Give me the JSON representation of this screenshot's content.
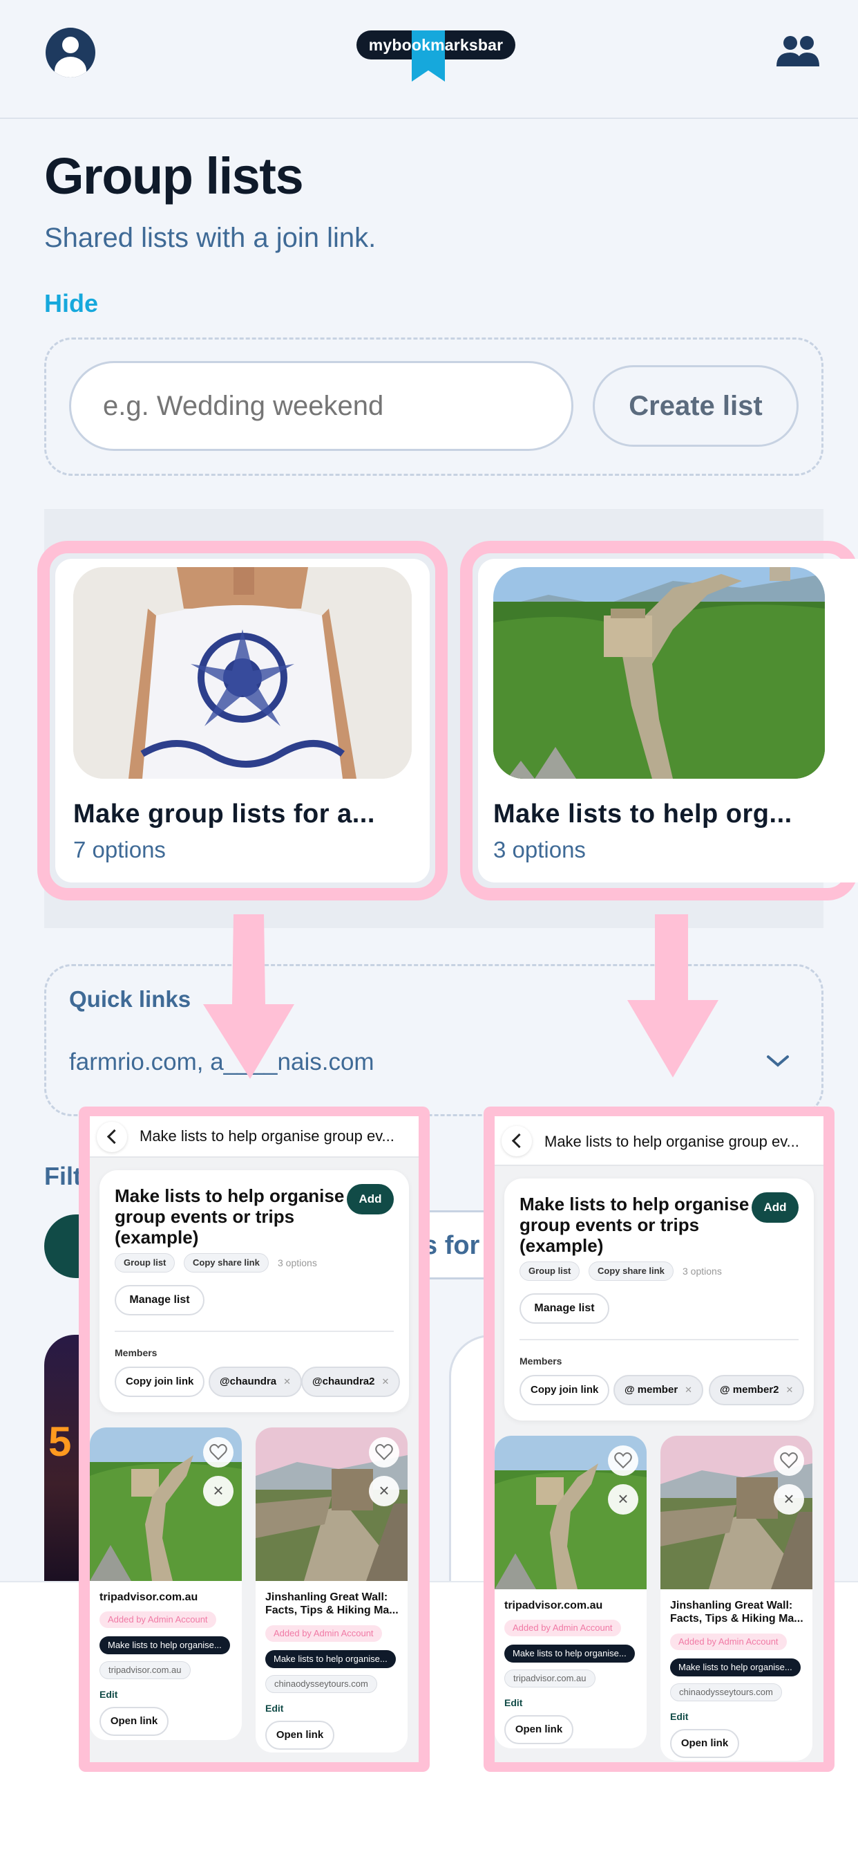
{
  "header": {
    "logo_text": "mybookmarksbar"
  },
  "page": {
    "title": "Group lists",
    "subtitle": "Shared lists with a join link.",
    "hide_label": "Hide"
  },
  "create": {
    "placeholder": "e.g. Wedding weekend",
    "button_label": "Create list"
  },
  "cards": [
    {
      "title": "Make group lists for a...",
      "count": "7 options"
    },
    {
      "title": "Make lists to help org...",
      "count": "3 options"
    }
  ],
  "quick_links": {
    "label": "Quick links",
    "value": "farmrio.com, a____nais.com"
  },
  "background": {
    "filter_label_partial": "Filt",
    "filter_chip_partial": "s for"
  },
  "panels": [
    {
      "top_title": "Make lists to help organise group ev...",
      "heading": "Make lists to help organise group events or trips (example)",
      "add_label": "Add",
      "tag_group": "Group list",
      "tag_share": "Copy share link",
      "options": "3 options",
      "manage_label": "Manage list",
      "members_label": "Members",
      "copy_join": "Copy join link",
      "member1": "@chaundra",
      "member2": "@chaundra2",
      "items": [
        {
          "title": "tripadvisor.com.au",
          "added_by": "Added by Admin Account",
          "list_badge": "Make lists to help organise...",
          "domain": "tripadvisor.com.au",
          "edit": "Edit",
          "open": "Open link"
        },
        {
          "title": "Jinshanling Great Wall: Facts, Tips & Hiking Ma...",
          "added_by": "Added by Admin Account",
          "list_badge": "Make lists to help organise...",
          "domain": "chinaodysseytours.com",
          "edit": "Edit",
          "open": "Open link"
        }
      ]
    },
    {
      "top_title": "Make lists to help organise group ev...",
      "heading": "Make lists to help organise group events or trips (example)",
      "add_label": "Add",
      "tag_group": "Group list",
      "tag_share": "Copy share link",
      "options": "3 options",
      "manage_label": "Manage list",
      "members_label": "Members",
      "copy_join": "Copy join link",
      "member1": "@ member",
      "member2": "@ member2",
      "items": [
        {
          "title": "tripadvisor.com.au",
          "added_by": "Added by Admin Account",
          "list_badge": "Make lists to help organise...",
          "domain": "tripadvisor.com.au",
          "edit": "Edit",
          "open": "Open link"
        },
        {
          "title": "Jinshanling Great Wall: Facts, Tips & Hiking Ma...",
          "added_by": "Added by Admin Account",
          "list_badge": "Make lists to help organise...",
          "domain": "chinaodysseytours.com",
          "edit": "Edit",
          "open": "Open link"
        }
      ]
    }
  ],
  "colors": {
    "accent": "#16a8dc",
    "highlight_pink": "#ffc0d6",
    "dark_green": "#114b47",
    "navy": "#0f1a2a"
  },
  "icons": [
    "user-avatar-icon",
    "group-people-icon",
    "chevron-down-icon",
    "back-chevron-icon",
    "heart-icon",
    "close-icon",
    "down-arrow-annotation"
  ]
}
